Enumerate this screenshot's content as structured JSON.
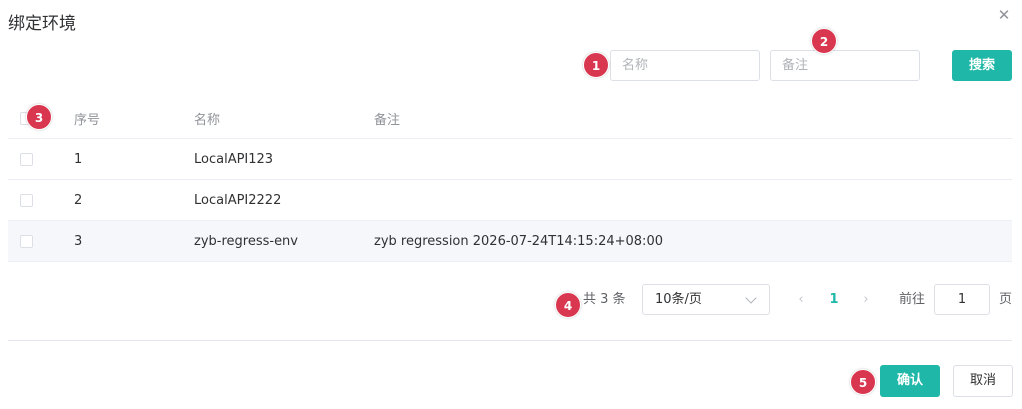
{
  "dialog": {
    "title": "绑定环境",
    "close_icon": "close-icon"
  },
  "search": {
    "name_placeholder": "名称",
    "name_value": "",
    "remark_placeholder": "备注",
    "remark_value": "",
    "button_label": "搜索"
  },
  "table": {
    "columns": [
      "序号",
      "名称",
      "备注"
    ],
    "rows": [
      {
        "index": "1",
        "name": "LocalAPI123",
        "remark": ""
      },
      {
        "index": "2",
        "name": "LocalAPI2222",
        "remark": ""
      },
      {
        "index": "3",
        "name": "zyb-regress-env",
        "remark": "zyb regression 2026-07-24T14:15:24+08:00"
      }
    ]
  },
  "pagination": {
    "total": "共 3 条",
    "page_size": "10条/页",
    "prev_icon": "chevron-left-icon",
    "current_page": "1",
    "next_icon": "chevron-right-icon",
    "goto_label": "前往",
    "goto_value": "1",
    "page_unit": "页"
  },
  "footer": {
    "confirm_label": "确认",
    "cancel_label": "取消"
  },
  "markers": [
    "1",
    "2",
    "3",
    "4",
    "5"
  ],
  "colors": {
    "primary": "#1fb8a8",
    "marker": "#d9364f",
    "row_highlight": "#f5f7fa"
  }
}
